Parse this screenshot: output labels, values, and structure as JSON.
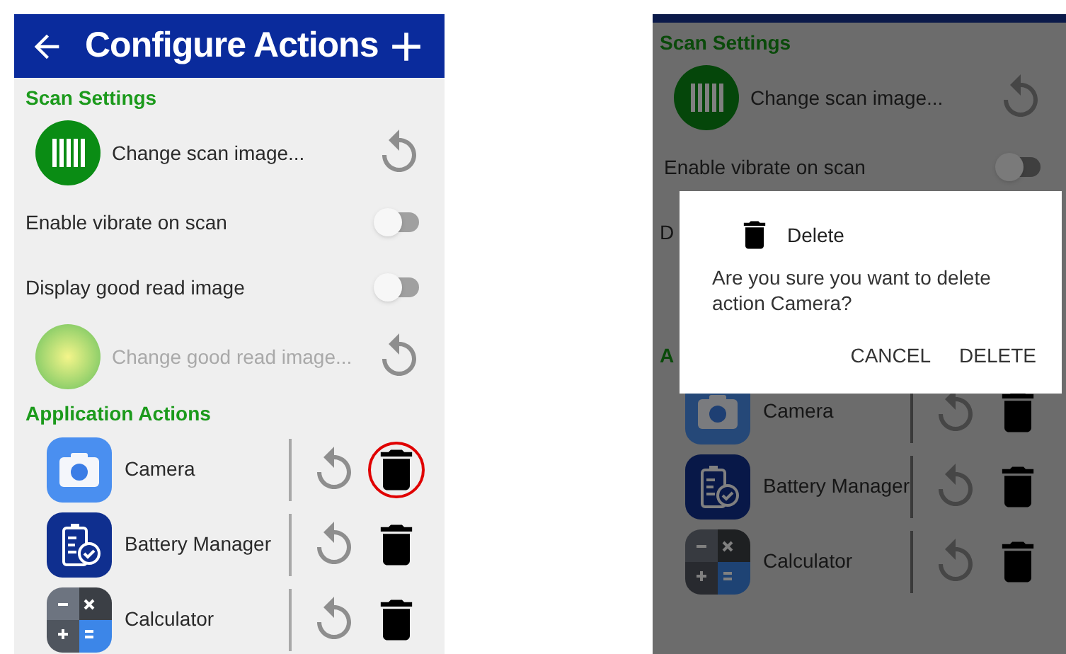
{
  "screens": [
    {
      "kind": "main",
      "app_bar": {
        "title": "Configure Actions"
      },
      "items": [
        {
          "kind": "section",
          "text": "Scan Settings"
        },
        {
          "kind": "barcode",
          "label": "Change scan image...",
          "disabled": false
        },
        {
          "kind": "toggle",
          "label": "Enable vibrate on scan",
          "on": false
        },
        {
          "kind": "toggle",
          "label": "Display good read image",
          "on": false
        },
        {
          "kind": "glow",
          "label": "Change good read image...",
          "disabled": true
        },
        {
          "kind": "section",
          "text": "Application Actions"
        },
        {
          "kind": "camera",
          "label": "Camera",
          "highlighted": true
        },
        {
          "kind": "battery",
          "label": "Battery Manager",
          "highlighted": false
        },
        {
          "kind": "calculator",
          "label": "Calculator",
          "highlighted": false
        }
      ]
    },
    {
      "kind": "dimmed",
      "items": [
        {
          "kind": "section",
          "text": "Scan Settings"
        },
        {
          "kind": "barcode",
          "label": "Change scan image...",
          "disabled": false
        },
        {
          "kind": "toggle",
          "label": "Enable vibrate on scan",
          "on": false
        },
        {
          "kind": "text_row",
          "text": "D"
        },
        {
          "kind": "section",
          "text": "A"
        },
        {
          "kind": "camera",
          "label": "Camera",
          "highlighted": false
        },
        {
          "kind": "battery",
          "label": "Battery Manager",
          "highlighted": false
        },
        {
          "kind": "calculator",
          "label": "Calculator",
          "highlighted": false
        }
      ],
      "dialog": {
        "title": "Delete",
        "message": "Are you sure you want to delete action Camera?",
        "buttons": [
          "CANCEL",
          "DELETE"
        ]
      }
    }
  ]
}
